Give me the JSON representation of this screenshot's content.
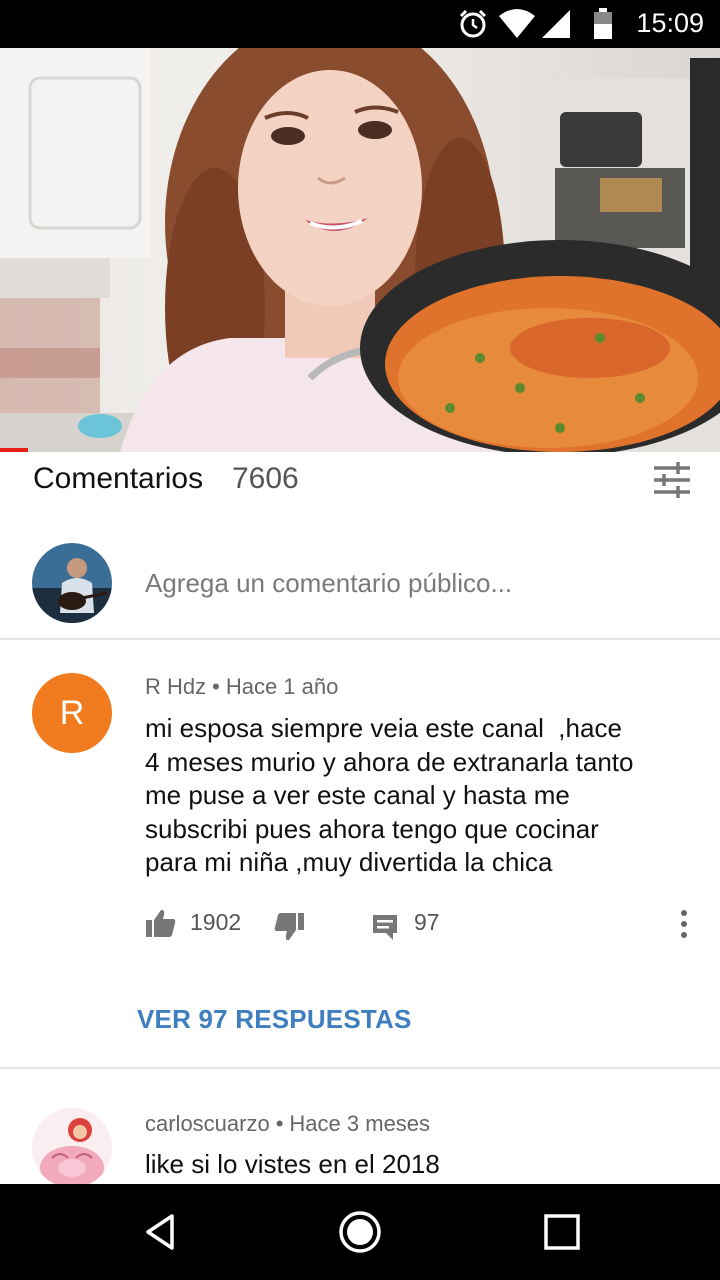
{
  "status_bar": {
    "time": "15:09",
    "icons": [
      "alarm-icon",
      "wifi-icon",
      "signal-icon",
      "battery-icon"
    ]
  },
  "video": {
    "progress_fraction": 0.04,
    "accent": "#e62117"
  },
  "comments_header": {
    "title": "Comentarios",
    "count": "7606",
    "sort_icon": "filter-sliders-icon"
  },
  "add_comment": {
    "placeholder": "Agrega un comentario público..."
  },
  "comments": [
    {
      "avatar_letter": "R",
      "avatar_color": "#f17c1f",
      "author": "R Hdz",
      "separator": "•",
      "time": "Hace 1 año",
      "lines": [
        "mi esposa siempre veia este canal  ,hace",
        "4 meses murio y ahora de extranarla tanto",
        "me puse a ver este canal y hasta me",
        "subscribi pues ahora tengo que cocinar",
        "para mi niña ,muy divertida la chica"
      ],
      "likes": "1902",
      "replies_count": "97",
      "view_replies": "VER 97 RESPUESTAS"
    },
    {
      "author": "carloscuarzo",
      "separator": "•",
      "time": "Hace 3 meses",
      "text": "like si lo vistes en el 2018"
    }
  ],
  "colors": {
    "link_blue": "#3f7fbf",
    "meta_gray": "#666666",
    "divider": "#e4e4e4"
  },
  "nav_bar": {
    "buttons": [
      "back-icon",
      "home-icon",
      "recents-icon"
    ]
  }
}
